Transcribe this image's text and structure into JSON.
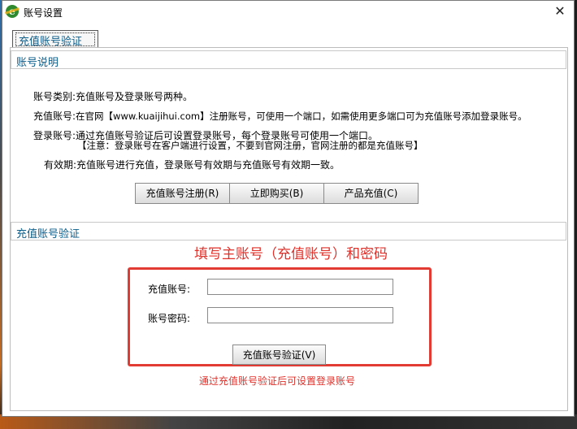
{
  "window": {
    "title": "账号设置",
    "close_glyph": "✕",
    "app_icon_letter": "e"
  },
  "tab": {
    "label": "充值账号验证"
  },
  "account_info": {
    "header": "账号说明",
    "type_label": "账号类别:",
    "type_value": "充值账号及登录账号两种。",
    "recharge_label": "充值账号:",
    "recharge_value": "在官网【www.kuaijihui.com】注册账号，可使用一个端口，如需使用更多端口可为充值账号添加登录账号。",
    "login_label": "登录账号:",
    "login_value": "通过充值账号验证后可设置登录账号，每个登录账号可使用一个端口。",
    "login_note": "【注意：登录账号在客户端进行设置，不要到官网注册，官网注册的都是充值账号】",
    "validity_label": "有效期:",
    "validity_value": "充值账号进行充值，登录账号有效期与充值账号有效期一致。"
  },
  "buttons": {
    "register": "充值账号注册(R)",
    "buy": "立即购买(B)",
    "recharge": "产品充值(C)"
  },
  "verify": {
    "header": "充值账号验证",
    "annotation_title": "填写主账号（充值账号）和密码",
    "account_label": "充值账号:",
    "account_value": "",
    "password_label": "账号密码:",
    "password_value": "",
    "verify_button": "充值账号验证(V)",
    "annotation_note": "通过充值账号验证后可设置登录账号"
  },
  "colors": {
    "accent_text": "#0b5d8a",
    "annotation_red": "#e0302a"
  }
}
